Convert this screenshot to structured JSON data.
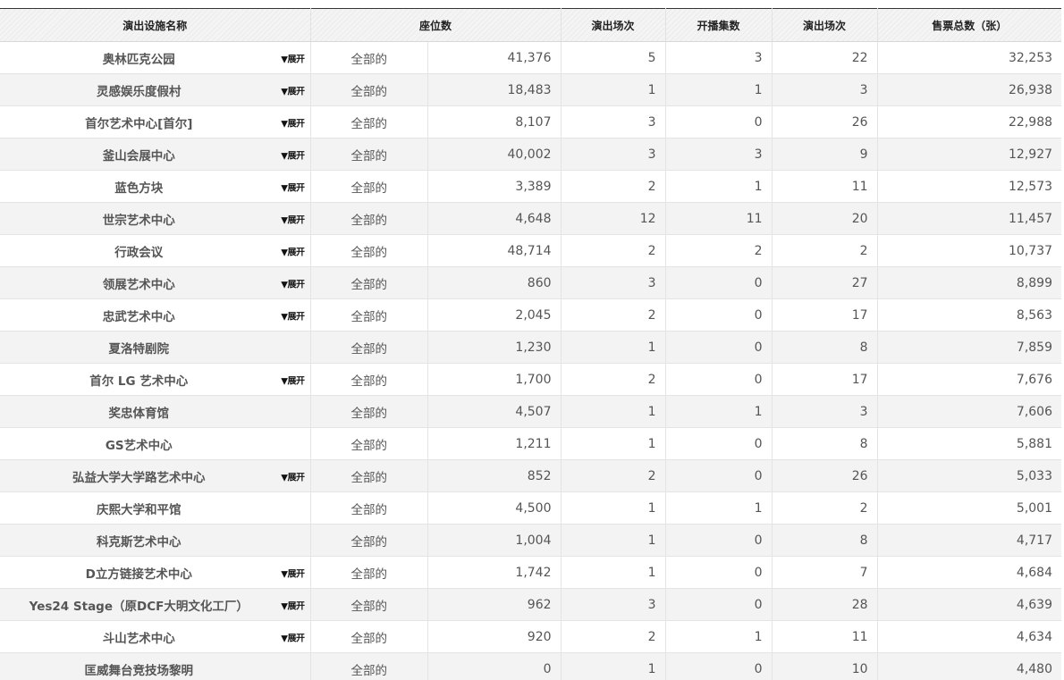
{
  "table": {
    "headers": {
      "venue": "演出设施名称",
      "seats": "座位数",
      "shows": "演出场次",
      "openings": "开播集数",
      "performances": "演出场次",
      "tickets": "售票总数（张）"
    },
    "rows": [
      {
        "name": "奥林匹克公园",
        "expand": "▼展开",
        "category": "全部的",
        "seats": "41,376",
        "shows": "5",
        "openings": "3",
        "performances": "22",
        "tickets": "32,253"
      },
      {
        "name": "灵感娱乐度假村",
        "expand": "▼展开",
        "category": "全部的",
        "seats": "18,483",
        "shows": "1",
        "openings": "1",
        "performances": "3",
        "tickets": "26,938"
      },
      {
        "name": "首尔艺术中心[首尔]",
        "expand": "▼展开",
        "category": "全部的",
        "seats": "8,107",
        "shows": "3",
        "openings": "0",
        "performances": "26",
        "tickets": "22,988"
      },
      {
        "name": "釜山会展中心",
        "expand": "▼展开",
        "category": "全部的",
        "seats": "40,002",
        "shows": "3",
        "openings": "3",
        "performances": "9",
        "tickets": "12,927"
      },
      {
        "name": "蓝色方块",
        "expand": "▼展开",
        "category": "全部的",
        "seats": "3,389",
        "shows": "2",
        "openings": "1",
        "performances": "11",
        "tickets": "12,573"
      },
      {
        "name": "世宗艺术中心",
        "expand": "▼展开",
        "category": "全部的",
        "seats": "4,648",
        "shows": "12",
        "openings": "11",
        "performances": "20",
        "tickets": "11,457"
      },
      {
        "name": "行政会议",
        "expand": "▼展开",
        "category": "全部的",
        "seats": "48,714",
        "shows": "2",
        "openings": "2",
        "performances": "2",
        "tickets": "10,737"
      },
      {
        "name": "领展艺术中心",
        "expand": "▼展开",
        "category": "全部的",
        "seats": "860",
        "shows": "3",
        "openings": "0",
        "performances": "27",
        "tickets": "8,899"
      },
      {
        "name": "忠武艺术中心",
        "expand": "▼展开",
        "category": "全部的",
        "seats": "2,045",
        "shows": "2",
        "openings": "0",
        "performances": "17",
        "tickets": "8,563"
      },
      {
        "name": "夏洛特剧院",
        "expand": "",
        "category": "全部的",
        "seats": "1,230",
        "shows": "1",
        "openings": "0",
        "performances": "8",
        "tickets": "7,859"
      },
      {
        "name": "首尔 LG 艺术中心",
        "expand": "▼展开",
        "category": "全部的",
        "seats": "1,700",
        "shows": "2",
        "openings": "0",
        "performances": "17",
        "tickets": "7,676"
      },
      {
        "name": "奖忠体育馆",
        "expand": "",
        "category": "全部的",
        "seats": "4,507",
        "shows": "1",
        "openings": "1",
        "performances": "3",
        "tickets": "7,606"
      },
      {
        "name": "GS艺术中心",
        "expand": "",
        "category": "全部的",
        "seats": "1,211",
        "shows": "1",
        "openings": "0",
        "performances": "8",
        "tickets": "5,881"
      },
      {
        "name": "弘益大学大学路艺术中心",
        "expand": "▼展开",
        "category": "全部的",
        "seats": "852",
        "shows": "2",
        "openings": "0",
        "performances": "26",
        "tickets": "5,033"
      },
      {
        "name": "庆熙大学和平馆",
        "expand": "",
        "category": "全部的",
        "seats": "4,500",
        "shows": "1",
        "openings": "1",
        "performances": "2",
        "tickets": "5,001"
      },
      {
        "name": "科克斯艺术中心",
        "expand": "",
        "category": "全部的",
        "seats": "1,004",
        "shows": "1",
        "openings": "0",
        "performances": "8",
        "tickets": "4,717"
      },
      {
        "name": "D立方链接艺术中心",
        "expand": "▼展开",
        "category": "全部的",
        "seats": "1,742",
        "shows": "1",
        "openings": "0",
        "performances": "7",
        "tickets": "4,684"
      },
      {
        "name": "Yes24 Stage（原DCF大明文化工厂）",
        "expand": "▼展开",
        "category": "全部的",
        "seats": "962",
        "shows": "3",
        "openings": "0",
        "performances": "28",
        "tickets": "4,639"
      },
      {
        "name": "斗山艺术中心",
        "expand": "▼展开",
        "category": "全部的",
        "seats": "920",
        "shows": "2",
        "openings": "1",
        "performances": "11",
        "tickets": "4,634"
      },
      {
        "name": "匡威舞台竞技场黎明",
        "expand": "",
        "category": "全部的",
        "seats": "0",
        "shows": "1",
        "openings": "0",
        "performances": "10",
        "tickets": "4,480"
      }
    ]
  }
}
